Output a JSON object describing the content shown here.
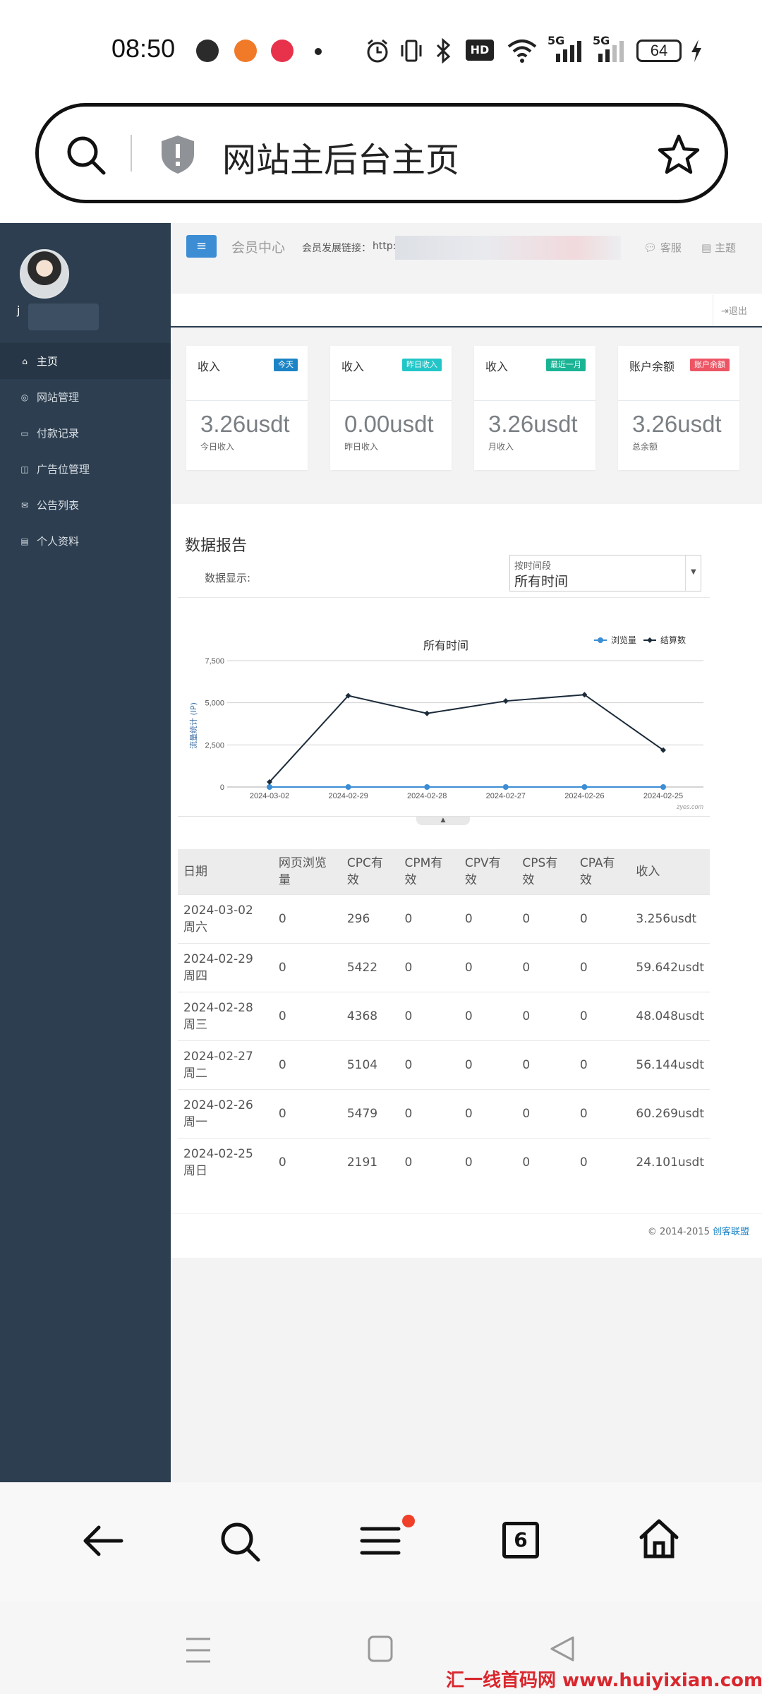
{
  "status_bar": {
    "time": "08:50",
    "battery": "64",
    "network": [
      "5G",
      "5G"
    ],
    "hd_label": "HD"
  },
  "browser": {
    "url_title": "网站主后台主页",
    "tabs_count": "6"
  },
  "header": {
    "section_title": "会员中心",
    "link_label": "会员发展链接：",
    "link_value": "http:/",
    "service_label": "客服",
    "theme_label": "主题",
    "logout_label": "退出"
  },
  "user": {
    "name_initial": "j"
  },
  "sidebar": {
    "items": [
      {
        "label": "主页",
        "icon": "home-icon",
        "active": true
      },
      {
        "label": "网站管理",
        "icon": "globe-icon",
        "active": false
      },
      {
        "label": "付款记录",
        "icon": "card-icon",
        "active": false
      },
      {
        "label": "广告位管理",
        "icon": "columns-icon",
        "active": false
      },
      {
        "label": "公告列表",
        "icon": "envelope-icon",
        "active": false
      },
      {
        "label": "个人资料",
        "icon": "id-card-icon",
        "active": false
      }
    ]
  },
  "cards": [
    {
      "title": "收入",
      "badge": "今天",
      "badge_color": "#1c84c6",
      "value": "3.26usdt",
      "sub": "今日收入"
    },
    {
      "title": "收入",
      "badge": "昨日收入",
      "badge_color": "#23c6c8",
      "value": "0.00usdt",
      "sub": "昨日收入"
    },
    {
      "title": "收入",
      "badge": "最近一月",
      "badge_color": "#1ab394",
      "value": "3.26usdt",
      "sub": "月收入"
    },
    {
      "title": "账户余额",
      "badge": "账户余额",
      "badge_color": "#ed5565",
      "value": "3.26usdt",
      "sub": "总余额"
    }
  ],
  "report": {
    "title": "数据报告",
    "display_label": "数据显示:",
    "select_label": "按时间段",
    "select_value": "所有时间"
  },
  "chart_data": {
    "type": "line",
    "title": "所有时间",
    "ylabel": "流量统计 (IP)",
    "categories": [
      "2024-03-02",
      "2024-02-29",
      "2024-02-28",
      "2024-02-27",
      "2024-02-26",
      "2024-02-25"
    ],
    "yticks": [
      "0",
      "2,500",
      "5,000",
      "7,500"
    ],
    "ylim": [
      0,
      7500
    ],
    "series": [
      {
        "name": "浏览量",
        "color": "#3c8dd4",
        "values": [
          0,
          0,
          0,
          0,
          0,
          0
        ]
      },
      {
        "name": "结算数",
        "color": "#1c2b3a",
        "values": [
          296,
          5422,
          4368,
          5104,
          5479,
          2191
        ]
      }
    ],
    "credit": "zyes.com",
    "legend": "top-right",
    "grid": true
  },
  "table": {
    "headers": [
      "日期",
      "网页浏览量",
      "CPC有效",
      "CPM有效",
      "CPV有效",
      "CPS有效",
      "CPA有效",
      "收入"
    ],
    "rows": [
      [
        "2024-03-02 周六",
        "0",
        "296",
        "0",
        "0",
        "0",
        "0",
        "3.256usdt"
      ],
      [
        "2024-02-29 周四",
        "0",
        "5422",
        "0",
        "0",
        "0",
        "0",
        "59.642usdt"
      ],
      [
        "2024-02-28 周三",
        "0",
        "4368",
        "0",
        "0",
        "0",
        "0",
        "48.048usdt"
      ],
      [
        "2024-02-27 周二",
        "0",
        "5104",
        "0",
        "0",
        "0",
        "0",
        "56.144usdt"
      ],
      [
        "2024-02-26 周一",
        "0",
        "5479",
        "0",
        "0",
        "0",
        "0",
        "60.269usdt"
      ],
      [
        "2024-02-25 周日",
        "0",
        "2191",
        "0",
        "0",
        "0",
        "0",
        "24.101usdt"
      ]
    ]
  },
  "footer": {
    "copyright": "© 2014-2015",
    "brand": "创客联盟"
  },
  "watermark": "汇一线首码网 www.huiyixian.com"
}
